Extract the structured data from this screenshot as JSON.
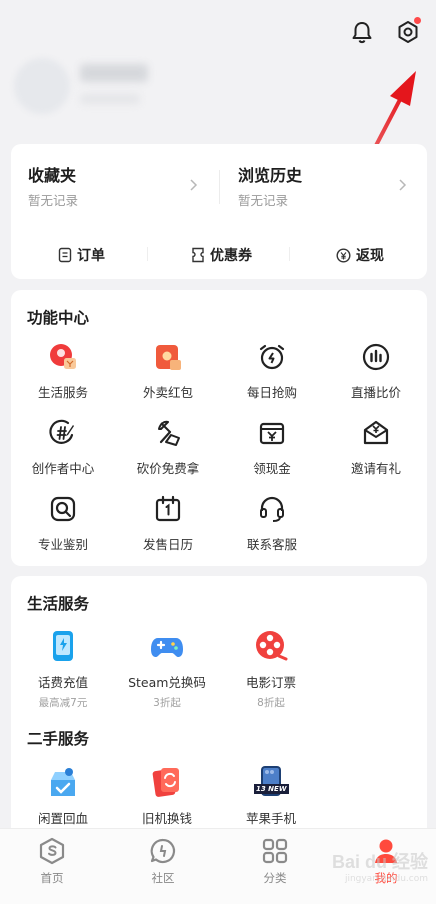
{
  "header": {
    "bell_icon": "bell-icon",
    "settings_icon": "settings-gear-icon",
    "notification_color": "#ff4a4a"
  },
  "profile": {
    "blurred": true
  },
  "top_card": {
    "favorites": {
      "title": "收藏夹",
      "subtitle": "暂无记录"
    },
    "history": {
      "title": "浏览历史",
      "subtitle": "暂无记录"
    },
    "quick": [
      {
        "label": "订单",
        "icon": "order-icon"
      },
      {
        "label": "优惠券",
        "icon": "coupon-icon"
      },
      {
        "label": "返现",
        "icon": "cashback-icon"
      }
    ]
  },
  "function_center": {
    "title": "功能中心",
    "items": [
      {
        "label": "生活服务",
        "icon": "life-service-icon"
      },
      {
        "label": "外卖红包",
        "icon": "takeout-redpacket-icon"
      },
      {
        "label": "每日抢购",
        "icon": "alarm-clock-icon"
      },
      {
        "label": "直播比价",
        "icon": "live-compare-icon"
      },
      {
        "label": "创作者中心",
        "icon": "creator-center-icon"
      },
      {
        "label": "砍价免费拿",
        "icon": "bargain-axe-icon"
      },
      {
        "label": "领现金",
        "icon": "cash-icon"
      },
      {
        "label": "邀请有礼",
        "icon": "invite-envelope-icon"
      },
      {
        "label": "专业鉴别",
        "icon": "appraisal-search-icon"
      },
      {
        "label": "发售日历",
        "icon": "calendar-icon"
      },
      {
        "label": "联系客服",
        "icon": "headset-icon"
      }
    ]
  },
  "life_services": {
    "title": "生活服务",
    "items": [
      {
        "label": "话费充值",
        "sub": "最高减7元",
        "icon": "phone-recharge-icon"
      },
      {
        "label": "Steam兑换码",
        "sub": "3折起",
        "icon": "gamepad-icon"
      },
      {
        "label": "电影订票",
        "sub": "8折起",
        "icon": "film-reel-icon"
      }
    ]
  },
  "second_hand": {
    "title": "二手服务",
    "items": [
      {
        "label": "闲置回血",
        "icon": "idle-box-icon"
      },
      {
        "label": "旧机换钱",
        "icon": "trade-in-phone-icon"
      },
      {
        "label": "苹果手机",
        "icon": "iphone-13-icon",
        "badge": "13 NEW"
      }
    ]
  },
  "tabbar": {
    "active_color": "#ff4a3d",
    "items": [
      {
        "label": "首页",
        "icon": "home-s-icon"
      },
      {
        "label": "社区",
        "icon": "community-chat-icon"
      },
      {
        "label": "分类",
        "icon": "category-grid-icon"
      },
      {
        "label": "我的",
        "icon": "profile-icon"
      }
    ]
  },
  "watermark": {
    "line1": "Bai du 经验",
    "line2": "jingyan.baidu.com"
  }
}
